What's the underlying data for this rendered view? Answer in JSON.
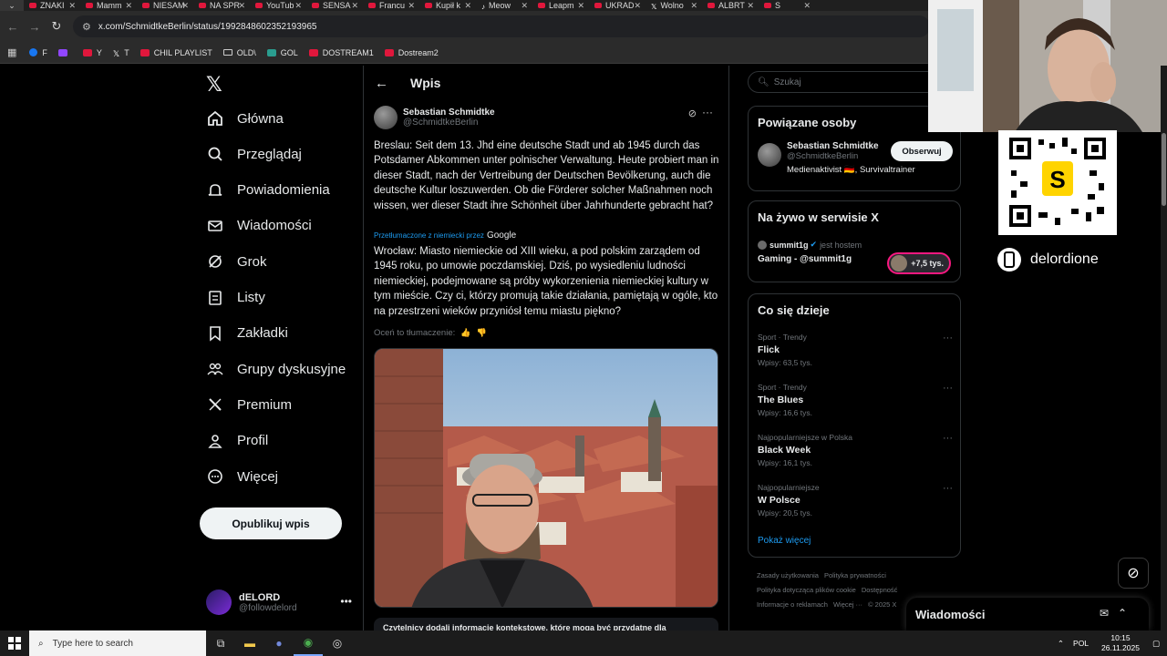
{
  "browser": {
    "tabs": [
      {
        "title": "ZNAKI",
        "icon": "youtube-icon"
      },
      {
        "title": "Mamm",
        "icon": "youtube-icon"
      },
      {
        "title": "NIESAM",
        "icon": "youtube-icon"
      },
      {
        "title": "NA SPR",
        "icon": "youtube-icon"
      },
      {
        "title": "YouTub",
        "icon": "youtube-icon"
      },
      {
        "title": "SENSA",
        "icon": "youtube-icon"
      },
      {
        "title": "Francu",
        "icon": "youtube-icon"
      },
      {
        "title": "Kupił k",
        "icon": "youtube-icon"
      },
      {
        "title": "Meow",
        "icon": "tiktok-icon"
      },
      {
        "title": "Leapm",
        "icon": "youtube-icon"
      },
      {
        "title": "UKRAD",
        "icon": "youtube-icon"
      },
      {
        "title": "Wolno",
        "icon": "x-icon"
      },
      {
        "title": "ALBRT",
        "icon": "youtube-icon"
      },
      {
        "title": "S",
        "icon": "youtube-icon"
      }
    ],
    "url": "x.com/SchmidtkeBerlin/status/1992848602352193965",
    "bookmarks": [
      {
        "label": "F",
        "icon": "facebook-icon"
      },
      {
        "label": "",
        "icon": "twitch-icon"
      },
      {
        "label": "Y",
        "icon": "youtube-icon"
      },
      {
        "label": "T",
        "icon": "x-icon"
      },
      {
        "label": "CHIL PLAYLIST",
        "icon": "youtube-icon"
      },
      {
        "label": "OLD\\",
        "icon": "folder-icon"
      },
      {
        "label": "GOL",
        "icon": "g-icon"
      },
      {
        "label": "DOSTREAM1",
        "icon": "youtube-icon"
      },
      {
        "label": "Dostream2",
        "icon": "youtube-icon"
      }
    ]
  },
  "leftnav": {
    "items": [
      {
        "label": "Główna",
        "icon": "home-icon"
      },
      {
        "label": "Przeglądaj",
        "icon": "search-icon"
      },
      {
        "label": "Powiadomienia",
        "icon": "bell-icon"
      },
      {
        "label": "Wiadomości",
        "icon": "mail-icon"
      },
      {
        "label": "Grok",
        "icon": "grok-icon"
      },
      {
        "label": "Listy",
        "icon": "list-icon"
      },
      {
        "label": "Zakładki",
        "icon": "bookmark-icon"
      },
      {
        "label": "Grupy dyskusyjne",
        "icon": "people-icon"
      },
      {
        "label": "Premium",
        "icon": "x-icon"
      },
      {
        "label": "Profil",
        "icon": "person-icon"
      },
      {
        "label": "Więcej",
        "icon": "more-circle-icon"
      }
    ],
    "post_button": "Opublikuj wpis",
    "account": {
      "name": "dELORD",
      "handle": "@followdelord"
    }
  },
  "post": {
    "header_title": "Wpis",
    "author_name": "Sebastian Schmidtke",
    "author_handle": "@SchmidtkeBerlin",
    "text_de": "Breslau: Seit dem 13. Jhd eine deutsche Stadt und ab 1945 durch das Potsdamer Abkommen unter polnischer Verwaltung. Heute probiert man in dieser Stadt, nach der Vertreibung der Deutschen Bevölkerung, auch die deutsche Kultur loszuwerden. Ob die Förderer solcher Maßnahmen noch wissen, wer dieser Stadt ihre Schönheit über Jahrhunderte gebracht hat?",
    "translated_label": "Przetłumaczone z niemiecki przez",
    "translated_by": "Google",
    "text_pl": "Wrocław: Miasto niemieckie od XIII wieku, a pod polskim zarządem od 1945 roku, po umowie poczdamskiej. Dziś, po wysiedleniu ludności niemieckiej, podejmowane są próby wykorzenienia niemieckiej kultury w tym mieście. Czy ci, którzy promują takie działania, pamiętają w ogóle, kto na przestrzeni wieków przyniósł temu miastu piękno?",
    "rate_label": "Oceń to tłumaczenie:",
    "context_note": "Czytelnicy dodali informacje kontekstowe, które mogą być przydatne dla"
  },
  "right": {
    "search_placeholder": "Szukaj",
    "related": {
      "title": "Powiązane osoby",
      "name": "Sebastian Schmidtke",
      "handle": "@SchmidtkeBerlin",
      "bio": "Medienaktivist 🇩🇪, Survivaltrainer",
      "follow_label": "Obserwuj"
    },
    "live": {
      "title": "Na żywo w serwisie X",
      "host": "summit1g",
      "host_suffix": "jest hostem",
      "stream_title": "Gaming - @summit1g",
      "listeners": "+7,5 tys."
    },
    "trends": {
      "title": "Co się dzieje",
      "items": [
        {
          "category": "Sport · Trendy",
          "name": "Flick",
          "count": "Wpisy: 63,5 tys."
        },
        {
          "category": "Sport · Trendy",
          "name": "The Blues",
          "count": "Wpisy: 16,6 tys."
        },
        {
          "category": "Najpopularniejsze w Polska",
          "name": "Black Week",
          "count": "Wpisy: 16,1 tys."
        },
        {
          "category": "Najpopularniejsze",
          "name": "W Polsce",
          "count": "Wpisy: 20,5 tys."
        }
      ],
      "show_more": "Pokaż więcej"
    },
    "footer": [
      "Zasady użytkowania",
      "Polityka prywatności",
      "Polityka dotycząca plików cookie",
      "Dostępność",
      "Informacje o reklamach",
      "Więcej ···",
      "© 2025 X"
    ]
  },
  "overlay": {
    "brand_name": "delordione",
    "dm_title": "Wiadomości"
  },
  "taskbar": {
    "search_placeholder": "Type here to search",
    "lang": "POL",
    "time": "10:15",
    "date": "26.11.2025"
  },
  "colors": {
    "accent": "#1d9bf0",
    "live_ring": "#f91880",
    "yt_red": "#e0173c"
  }
}
